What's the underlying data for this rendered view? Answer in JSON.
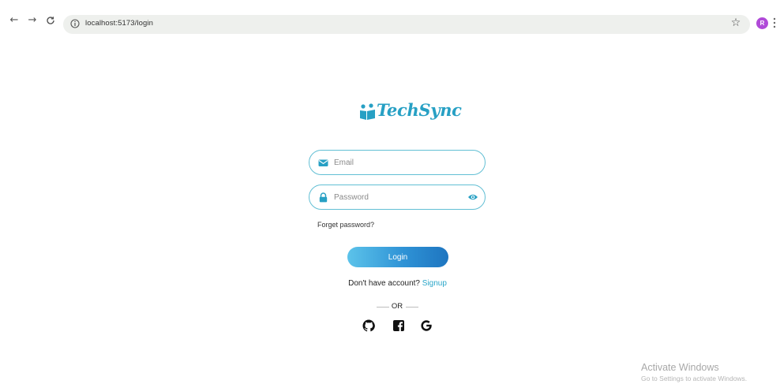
{
  "browser": {
    "back_icon": "arrow-left-icon",
    "forward_icon": "arrow-right-icon",
    "reload_icon": "reload-icon",
    "url": "localhost:5173/login",
    "profile_initial": "R",
    "profile_color": "#b04ad8"
  },
  "logo": {
    "text": "TechSync",
    "color": "#27a0c4"
  },
  "form": {
    "email_placeholder": "Email",
    "password_placeholder": "Password",
    "forget_password": "Forget password?",
    "login_label": "Login",
    "no_account_text": "Don't have account?",
    "signup_label": "Signup",
    "or_text": "OR"
  },
  "social": [
    "github-icon",
    "facebook-icon",
    "google-icon"
  ],
  "colors": {
    "accent": "#27a0c4",
    "field_border": "#62bfd4",
    "button_start": "#5cc3ea",
    "button_end": "#1e75c0"
  },
  "watermark": {
    "title": "Activate Windows",
    "subtitle": "Go to Settings to activate Windows."
  }
}
